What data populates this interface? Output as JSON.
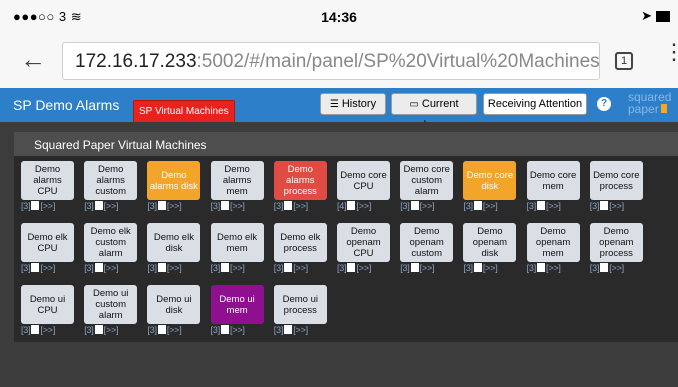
{
  "status_bar": {
    "carrier": "●●●○○ 3 ≋",
    "time": "14:36",
    "location_icon": "➤"
  },
  "browser": {
    "url_host": "172.16.17.233",
    "url_rest": ":5002/#/main/panel/SP%20Virtual%20Machines",
    "tab_count": "1",
    "back_icon": "←",
    "menu_icon": "⋮"
  },
  "header": {
    "title": "SP Demo Alarms",
    "panel_badge": "SP Virtual Machines",
    "history": "History",
    "current_alarms": "Current alarms",
    "receiving_attention": "Receiving Attention",
    "help": "?",
    "logo_line1": "squared",
    "logo_line2": "paper"
  },
  "panel": {
    "title": "Squared Paper Virtual Machines",
    "tiles": [
      {
        "label": "Demo alarms CPU",
        "footer": "[3]",
        "color": "normal"
      },
      {
        "label": "Demo alarms custom",
        "footer": "[3]",
        "color": "normal"
      },
      {
        "label": "Demo alarms disk",
        "footer": "[3]",
        "color": "orange"
      },
      {
        "label": "Demo alarms mem",
        "footer": "[3]",
        "color": "normal"
      },
      {
        "label": "Demo alarms process",
        "footer": "[3]",
        "color": "red"
      },
      {
        "label": "Demo core CPU",
        "footer": "[4]",
        "color": "normal"
      },
      {
        "label": "Demo core custom alarm",
        "footer": "[3]",
        "color": "normal"
      },
      {
        "label": "Demo core disk",
        "footer": "[3]",
        "color": "orange"
      },
      {
        "label": "Demo core mem",
        "footer": "[3]",
        "color": "normal"
      },
      {
        "label": "Demo core process",
        "footer": "[3]",
        "color": "normal"
      },
      {
        "label": "Demo elk CPU",
        "footer": "[3]",
        "color": "normal"
      },
      {
        "label": "Demo elk custom alarm",
        "footer": "[3]",
        "color": "normal"
      },
      {
        "label": "Demo elk disk",
        "footer": "[3]",
        "color": "normal"
      },
      {
        "label": "Demo elk mem",
        "footer": "[3]",
        "color": "normal"
      },
      {
        "label": "Demo elk process",
        "footer": "[3]",
        "color": "normal"
      },
      {
        "label": "Demo openam CPU",
        "footer": "[3]",
        "color": "normal"
      },
      {
        "label": "Demo openam custom",
        "footer": "[3]",
        "color": "normal"
      },
      {
        "label": "Demo openam disk",
        "footer": "[3]",
        "color": "normal"
      },
      {
        "label": "Demo openam mem",
        "footer": "[3]",
        "color": "normal"
      },
      {
        "label": "Demo openam process",
        "footer": "[3]",
        "color": "normal"
      },
      {
        "label": "Demo ui CPU",
        "footer": "[3]",
        "color": "normal"
      },
      {
        "label": "Demo ui custom alarm",
        "footer": "[3]",
        "color": "normal"
      },
      {
        "label": "Demo ui disk",
        "footer": "[3]",
        "color": "normal"
      },
      {
        "label": "Demo ui mem",
        "footer": "[3]",
        "color": "purple"
      },
      {
        "label": "Demo ui process",
        "footer": "[3]",
        "color": "normal"
      }
    ],
    "footer_action": "[>>]"
  },
  "colors": {
    "header_blue": "#2c7fc8",
    "badge_red": "#e8231d",
    "tile_orange": "#f3a42a",
    "tile_red": "#e04b44",
    "tile_purple": "#8e0f90"
  }
}
